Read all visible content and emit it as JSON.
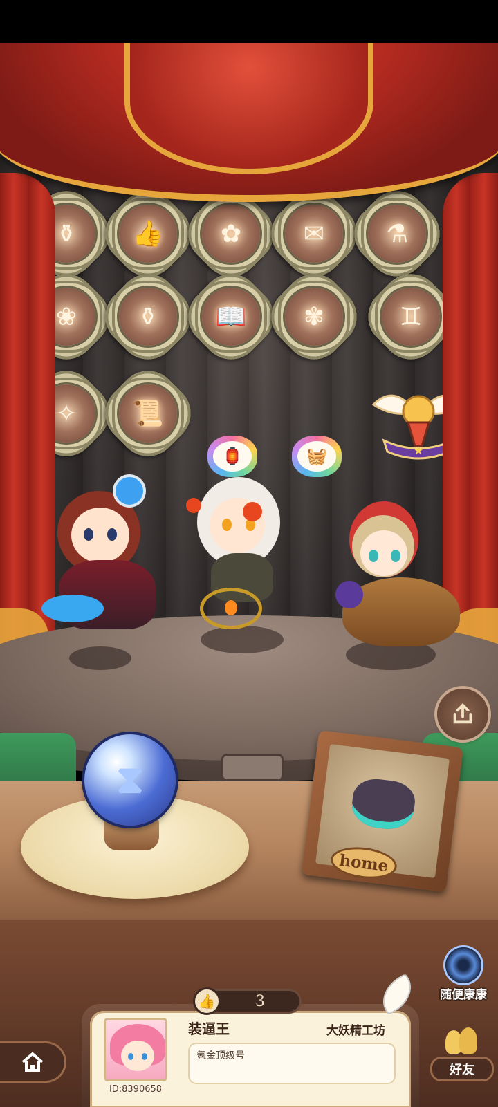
{
  "colors": {
    "curtain_red": "#b32a20",
    "curtain_gold": "#e6a63c",
    "card_bg": "#fbf2dc",
    "dark_brown": "#3a2418"
  },
  "badges": [
    {
      "icon": "cauldron-icon",
      "glyph": "⚱"
    },
    {
      "icon": "thumbs-up-icon",
      "glyph": "👍"
    },
    {
      "icon": "sprout-icon",
      "glyph": "✿"
    },
    {
      "icon": "certificate-icon",
      "glyph": "✉"
    },
    {
      "icon": "cauldron-icon",
      "glyph": "⚗"
    },
    {
      "icon": "plant-pot-icon",
      "glyph": "❀"
    },
    {
      "icon": "cauldron-icon",
      "glyph": "⚱"
    },
    {
      "icon": "book-icon",
      "glyph": "📖"
    },
    {
      "icon": "flower-icon",
      "glyph": "✾"
    },
    {
      "icon": "twins-icon",
      "glyph": "♊"
    },
    {
      "icon": "fairy-icon",
      "glyph": "✧"
    },
    {
      "icon": "scroll-icon",
      "glyph": "📜"
    }
  ],
  "tokens": [
    {
      "icon": "lantern-icon",
      "glyph": "🏮"
    },
    {
      "icon": "basket-icon",
      "glyph": "🧺"
    }
  ],
  "stage": {
    "home_plate": "home",
    "random_visit_label": "随便康康"
  },
  "profile": {
    "like_count": "3",
    "player_name": "装逼王",
    "workshop_name": "大妖精工坊",
    "signature": "氪金顶级号",
    "player_id": "ID:8390658"
  },
  "nav": {
    "friends_label": "好友"
  }
}
